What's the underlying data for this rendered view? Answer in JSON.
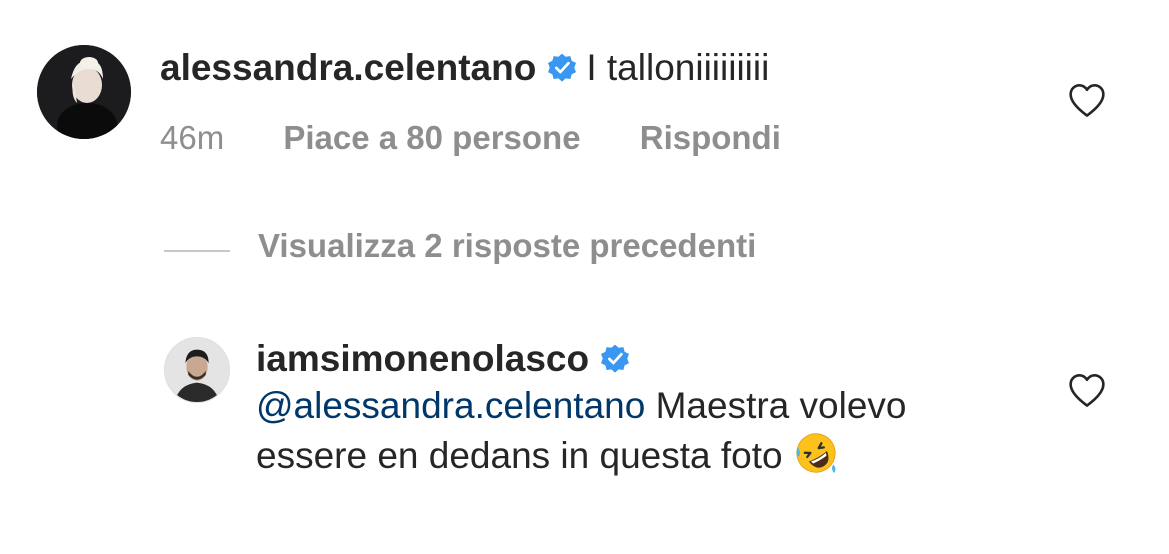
{
  "comment": {
    "username": "alessandra.celentano",
    "text": "I talloniiiiiiiii",
    "time": "46m",
    "likes": "Piace a 80 persone",
    "reply_label": "Rispondi",
    "avatar_icon": "profile-photo-blonde-woman",
    "verified_icon": "verified-badge-icon",
    "heart_icon": "heart-outline-icon"
  },
  "view_replies": {
    "label": "Visualizza 2 risposte precedenti"
  },
  "reply": {
    "username": "iamsimonenolasco",
    "mention": "@alessandra.celentano",
    "text_after_mention": " Maestra volevo essere en dedans in questa foto",
    "emoji": "rolling-on-floor-laughing-emoji",
    "avatar_icon": "profile-photo-man",
    "verified_icon": "verified-badge-icon",
    "heart_icon": "heart-outline-icon"
  },
  "colors": {
    "text_primary": "#262626",
    "text_secondary": "#8e8e8e",
    "mention": "#00376b",
    "verified": "#3897f0"
  }
}
